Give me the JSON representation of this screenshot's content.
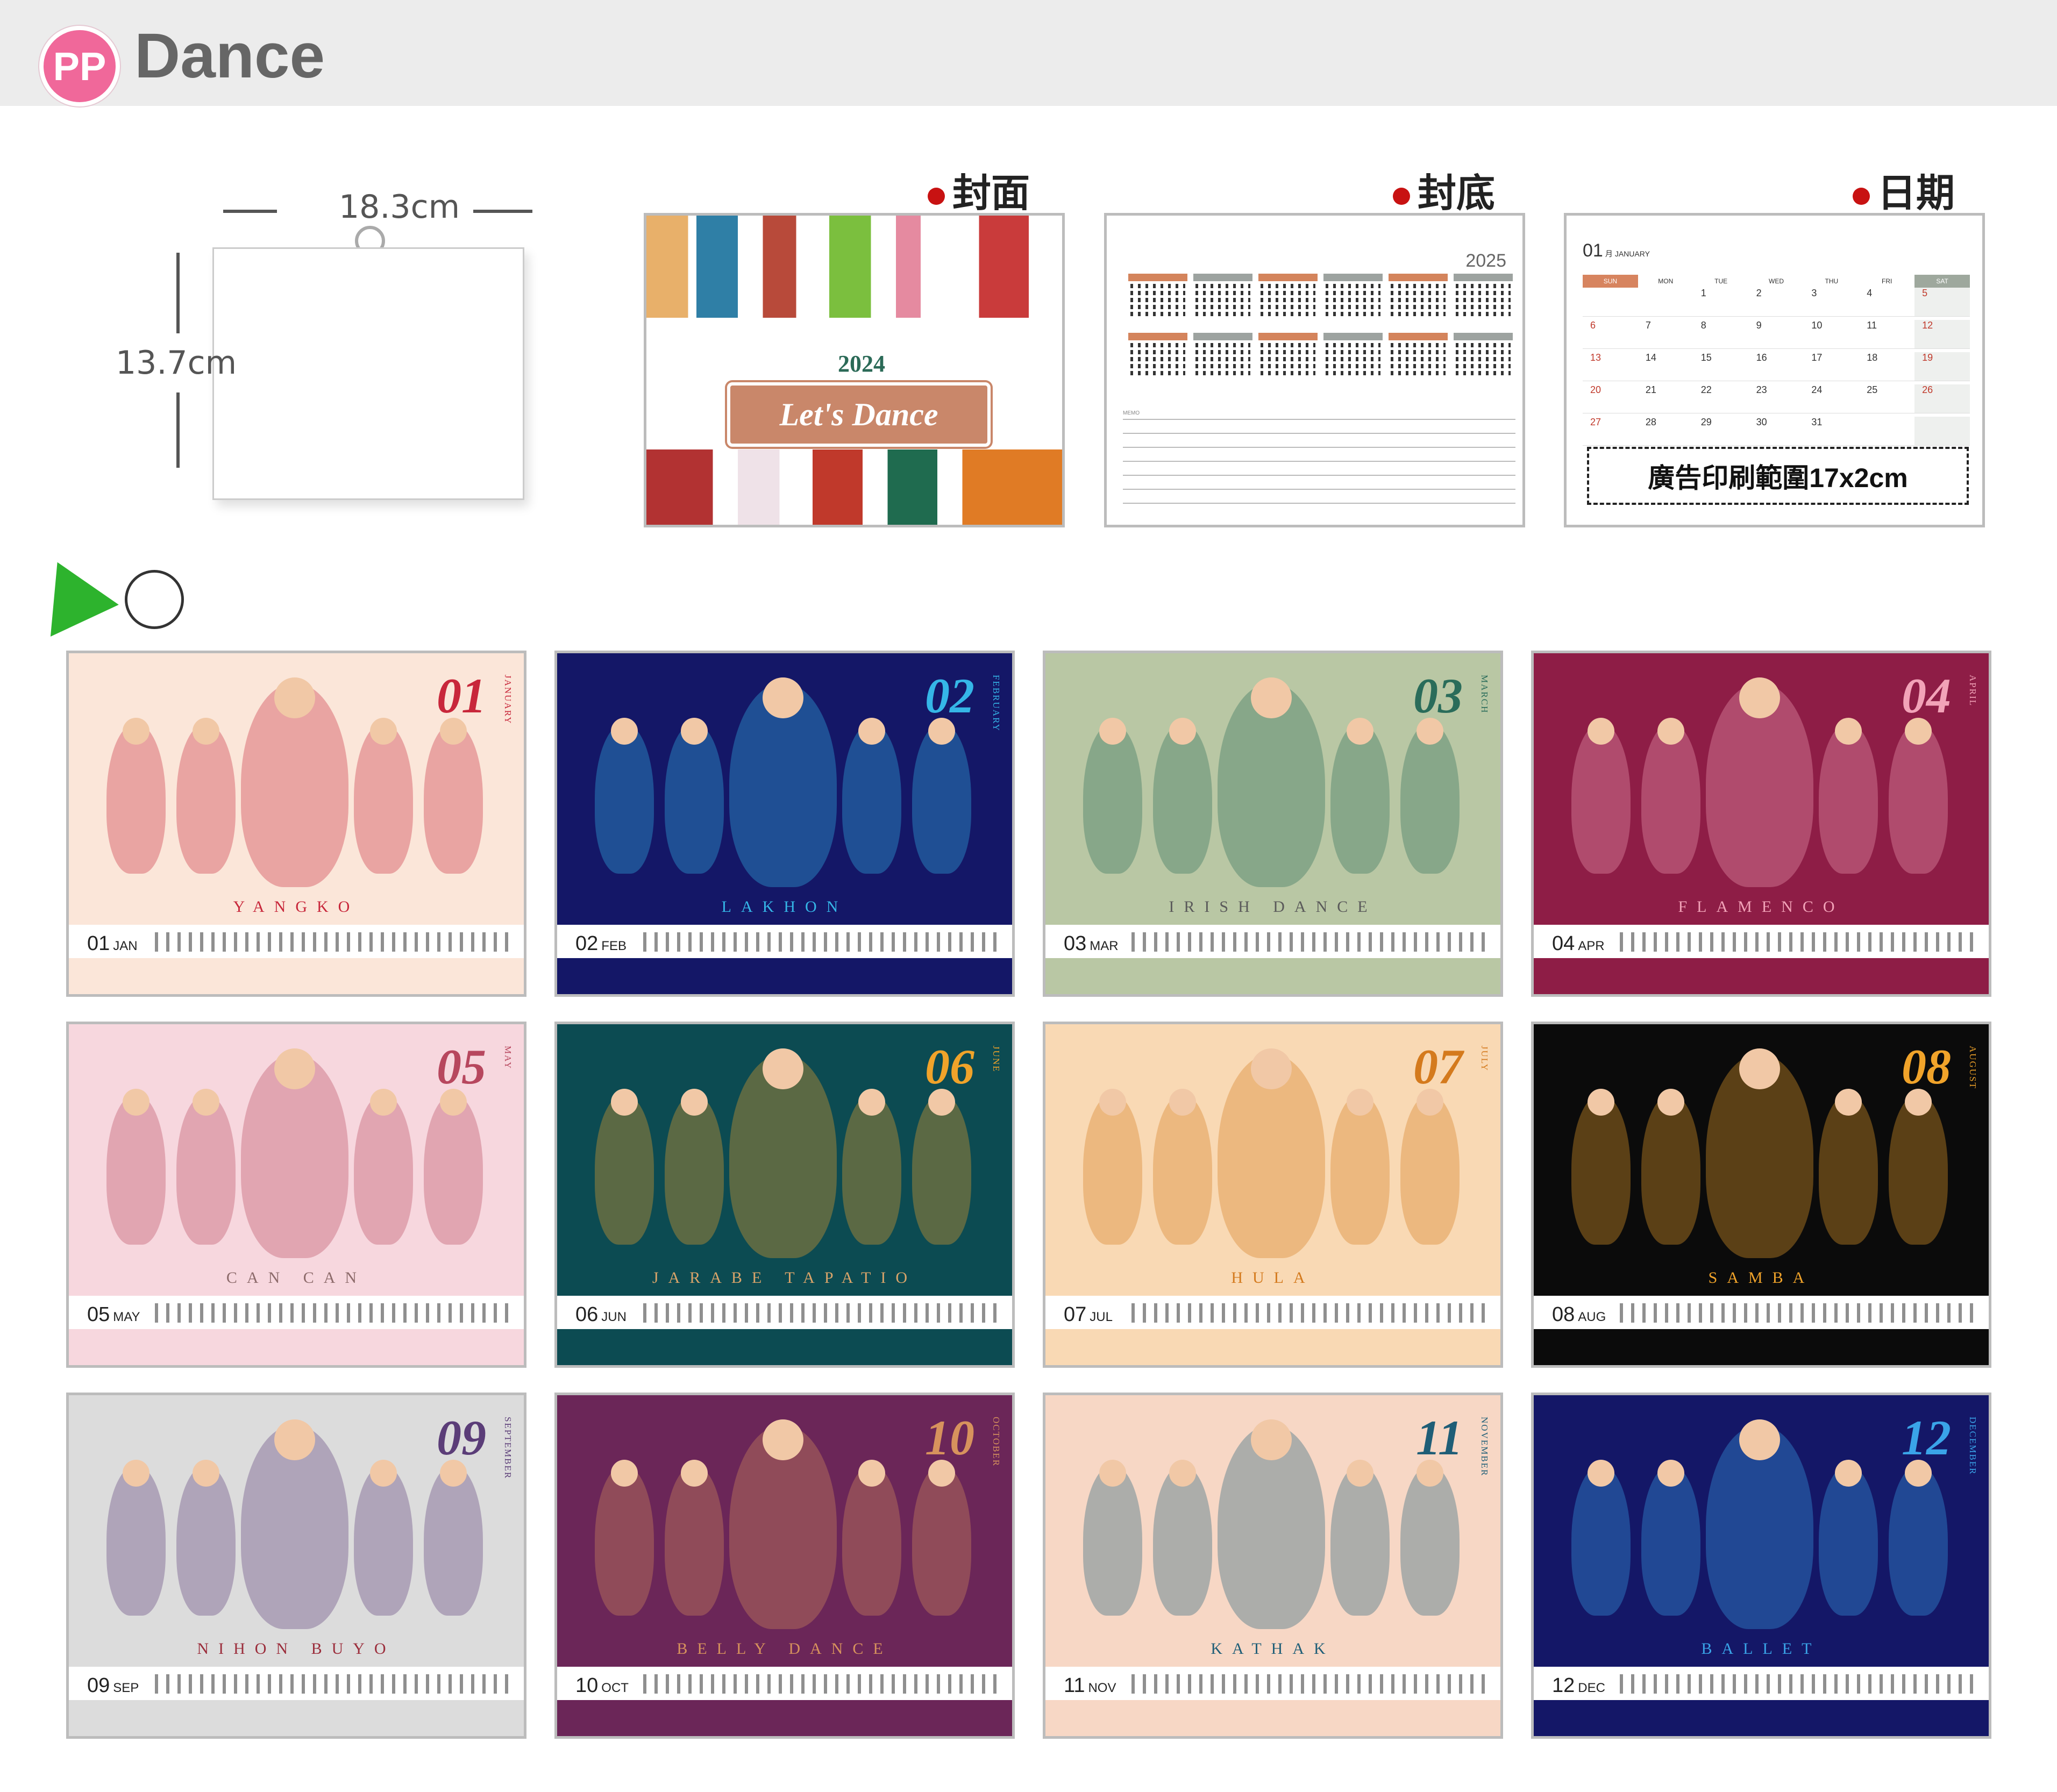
{
  "header": {
    "logo": "PP",
    "title": "Dance"
  },
  "dims": {
    "width": "18.3cm",
    "height": "13.7cm"
  },
  "labels": {
    "cover": "封面",
    "back": "封底",
    "date": "日期"
  },
  "cover": {
    "year": "2024",
    "plaque": "Let's Dance"
  },
  "back": {
    "year": "2025",
    "memo": "MEMO"
  },
  "datepage": {
    "month": "01",
    "month_cn": "月",
    "month_en": "JANUARY",
    "weekdays": [
      "SUN",
      "MON",
      "TUE",
      "WED",
      "THU",
      "FRI",
      "SAT"
    ],
    "ad": "廣告印刷範圍17x2cm"
  },
  "colors": {
    "accent": "#f0689a",
    "red_dot": "#c81212",
    "cover_orange": "#c9876a"
  },
  "months": [
    {
      "num": "01",
      "abbr": "JAN",
      "full": "JANUARY",
      "dance": "YANGKO",
      "bg": "#fbe6d9",
      "foot": "#fbe6d9",
      "numColor": "#c8273b",
      "danceColor": "#c8273b"
    },
    {
      "num": "02",
      "abbr": "FEB",
      "full": "FEBRUARY",
      "dance": "LAKHON",
      "bg": "#141767",
      "foot": "#141767",
      "numColor": "#35b6e7",
      "danceColor": "#35b6e7"
    },
    {
      "num": "03",
      "abbr": "MAR",
      "full": "MARCH",
      "dance": "IRISH DANCE",
      "bg": "#b9c7a4",
      "foot": "#b9c7a4",
      "numColor": "#2a6c5a",
      "danceColor": "#5a5a5a"
    },
    {
      "num": "04",
      "abbr": "APR",
      "full": "APRIL",
      "dance": "FLAMENCO",
      "bg": "#8e1d46",
      "foot": "#8e1d46",
      "numColor": "#f2a3b8",
      "danceColor": "#f2a3b8"
    },
    {
      "num": "05",
      "abbr": "MAY",
      "full": "MAY",
      "dance": "CAN CAN",
      "bg": "#f7d7de",
      "foot": "#f7d7de",
      "numColor": "#b7475e",
      "danceColor": "#8d6b6b"
    },
    {
      "num": "06",
      "abbr": "JUN",
      "full": "JUNE",
      "dance": "JARABE TAPATIO",
      "bg": "#0c4b52",
      "foot": "#0c4b52",
      "numColor": "#f0a32a",
      "danceColor": "#d9a46a"
    },
    {
      "num": "07",
      "abbr": "JUL",
      "full": "JULY",
      "dance": "HULA",
      "bg": "#f9d9b4",
      "foot": "#f9d9b4",
      "numColor": "#d47a1d",
      "danceColor": "#d47a1d"
    },
    {
      "num": "08",
      "abbr": "AUG",
      "full": "AUGUST",
      "dance": "SAMBA",
      "bg": "#0b0b0b",
      "foot": "#0b0b0b",
      "numColor": "#f0a32a",
      "danceColor": "#f0a32a"
    },
    {
      "num": "09",
      "abbr": "SEP",
      "full": "SEPTEMBER",
      "dance": "NIHON BUYO",
      "bg": "#dcdcdc",
      "foot": "#dcdcdc",
      "numColor": "#5b3d78",
      "danceColor": "#9b2d3b"
    },
    {
      "num": "10",
      "abbr": "OCT",
      "full": "OCTOBER",
      "dance": "BELLY DANCE",
      "bg": "#6b2658",
      "foot": "#6b2658",
      "numColor": "#d7925d",
      "danceColor": "#d7925d"
    },
    {
      "num": "11",
      "abbr": "NOV",
      "full": "NOVEMBER",
      "dance": "KATHAK",
      "bg": "#f7d7c5",
      "foot": "#f7d7c5",
      "numColor": "#1f5e77",
      "danceColor": "#1f5e77"
    },
    {
      "num": "12",
      "abbr": "DEC",
      "full": "DECEMBER",
      "dance": "BALLET",
      "bg": "#141767",
      "foot": "#141767",
      "numColor": "#3aa4e8",
      "danceColor": "#3aa4e8"
    }
  ]
}
